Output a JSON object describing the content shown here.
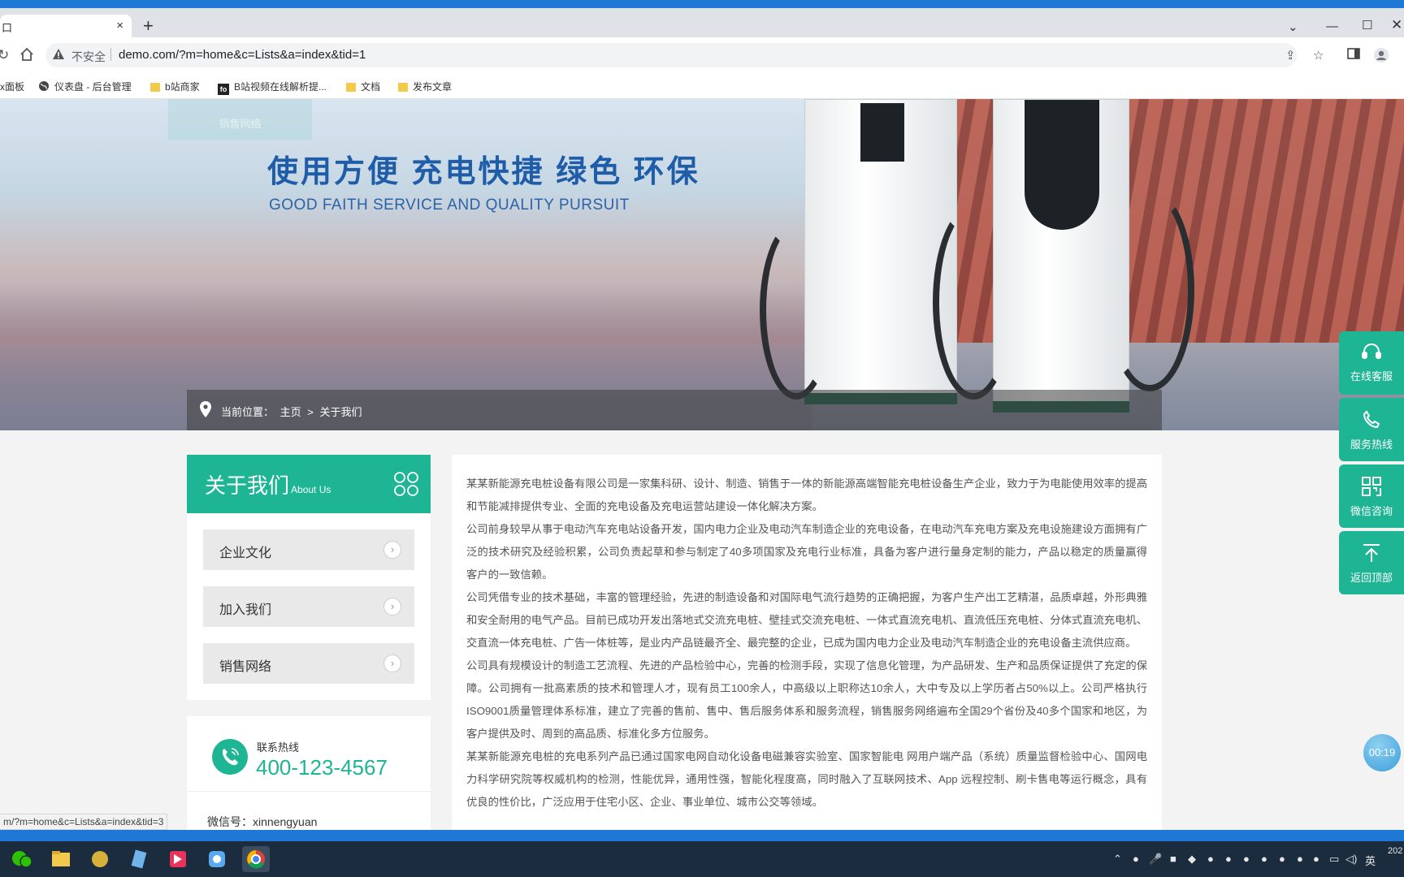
{
  "browser": {
    "tab_title": "口",
    "tab_close": "×",
    "new_tab": "+",
    "security": "不安全",
    "url": "demo.com/?m=home&c=Lists&a=index&tid=1",
    "bookmarks": [
      {
        "label": "x面板",
        "icon": "none"
      },
      {
        "label": "仪表盘 - 后台管理",
        "icon": "globe-icon"
      },
      {
        "label": "b站商家",
        "icon": "folder-icon"
      },
      {
        "label": "B站视频在线解析提...",
        "icon": "fo-icon"
      },
      {
        "label": "文档",
        "icon": "folder-icon"
      },
      {
        "label": "发布文章",
        "icon": "folder-icon"
      }
    ],
    "fo_badge": "fo"
  },
  "banner": {
    "ghost_button": "销售网络",
    "slogan": "使用方便  充电快捷  绿色  环保",
    "slogan_en": "GOOD FAITH SERVICE AND QUALITY PURSUIT",
    "breadcrumb_label": "当前位置：",
    "breadcrumb_home": "主页",
    "breadcrumb_sep": ">",
    "breadcrumb_current": "关于我们"
  },
  "sidebar": {
    "title": "关于我们",
    "title_en": "About Us",
    "items": [
      {
        "label": "企业文化"
      },
      {
        "label": "加入我们"
      },
      {
        "label": "销售网络"
      }
    ],
    "arrow": "›"
  },
  "contact": {
    "hotline_label": "联系热线",
    "hotline_number": "400-123-4567",
    "wechat": "微信号：xinnengyuan"
  },
  "article": {
    "paragraphs": [
      "某某新能源充电桩设备有限公司是一家集科研、设计、制造、销售于一体的新能源高端智能充电桩设备生产企业，致力于为电能使用效率的提高和节能减排提供专业、全面的充电设备及充电运营站建设一体化解决方案。",
      "公司前身较早从事于电动汽车充电站设备开发，国内电力企业及电动汽车制造企业的充电设备，在电动汽车充电方案及充电设施建设方面拥有广泛的技术研究及经验积累，公司负责起草和参与制定了40多项国家及充电行业标准，具备为客户进行量身定制的能力，产品以稳定的质量赢得客户的一致信赖。",
      "公司凭借专业的技术基础，丰富的管理经验，先进的制造设备和对国际电气流行趋势的正确把握，为客户生产出工艺精湛，品质卓越，外形典雅和安全耐用的电气产品。目前已成功开发出落地式交流充电桩、壁挂式交流充电桩、一体式直流充电机、直流低压充电桩、分体式直流充电机、交直流一体充电桩、广告一体桩等，是业内产品链最齐全、最完整的企业，已成为国内电力企业及电动汽车制造企业的充电设备主流供应商。",
      "公司具有规模设计的制造工艺流程、先进的产品检验中心，完善的检测手段，实现了信息化管理，为产品研发、生产和品质保证提供了充定的保障。公司拥有一批高素质的技术和管理人才，现有员工100余人，中高级以上职称达10余人，大中专及以上学历者占50%以上。公司严格执行ISO9001质量管理体系标准，建立了完善的售前、售中、售后服务体系和服务流程，销售服务网络遍布全国29个省份及40多个国家和地区，为客户提供及时、周到的高品质、标准化多方位服务。",
      "某某新能源充电桩的充电系列产品已通过国家电网自动化设备电磁兼容实验室、国家智能电 网用户端产品（系统）质量监督检验中心、国网电力科学研究院等权威机构的检测，性能优异，通用性强，智能化程度高，同时融入了互联网技术、App 远程控制、刷卡售电等运行概念，具有优良的性价比，广泛应用于住宅小区、企业、事业单位、城市公交等领域。"
    ]
  },
  "floatbar": [
    {
      "label": "在线客服",
      "icon": "headset-icon"
    },
    {
      "label": "服务热线",
      "icon": "phone-icon"
    },
    {
      "label": "微信咨询",
      "icon": "qrcode-icon"
    },
    {
      "label": "返回顶部",
      "icon": "back-to-top-icon"
    }
  ],
  "timer": "00:19",
  "status_url": "m/?m=home&c=Lists&a=index&tid=3",
  "tray": {
    "ime": "英",
    "year": "202"
  },
  "colors": {
    "accent": "#1db594",
    "slogan": "#1f5da8",
    "taskbar": "#1b2c3f"
  }
}
